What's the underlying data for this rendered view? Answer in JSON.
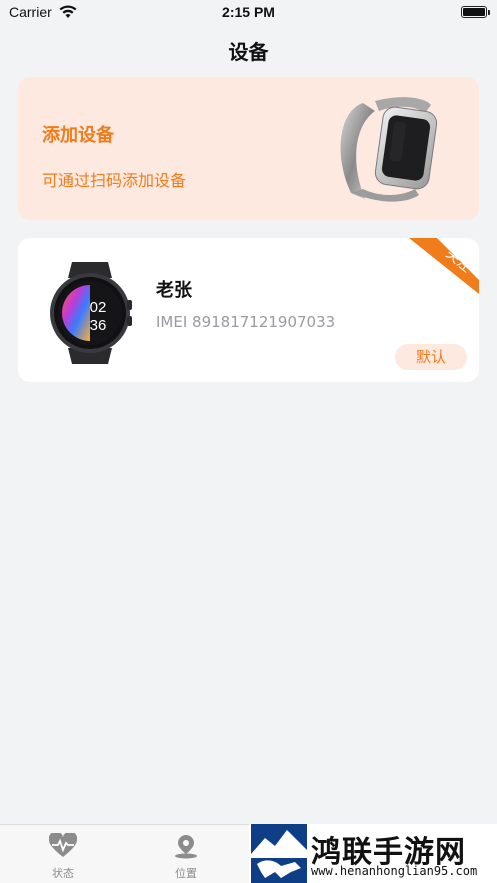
{
  "status_bar": {
    "carrier": "Carrier",
    "time": "2:15 PM"
  },
  "nav": {
    "title": "设备"
  },
  "add_device": {
    "title": "添加设备",
    "subtitle": "可通过扫码添加设备"
  },
  "device": {
    "name": "老张",
    "imei": "IMEI 891817121907033",
    "default_label": "默认",
    "follow_label": "关注",
    "watch_time_hour": "02",
    "watch_time_minute": "36"
  },
  "tabs": [
    {
      "label": "状态",
      "icon": "heart-pulse-icon"
    },
    {
      "label": "位置",
      "icon": "location-pin-icon"
    }
  ],
  "watermark": {
    "title": "鸿联手游网",
    "url": "www.henanhonglian95.com"
  },
  "colors": {
    "accent": "#f07c1c",
    "accent_bg": "#fde9e0",
    "page_bg": "#f2f3f5"
  }
}
